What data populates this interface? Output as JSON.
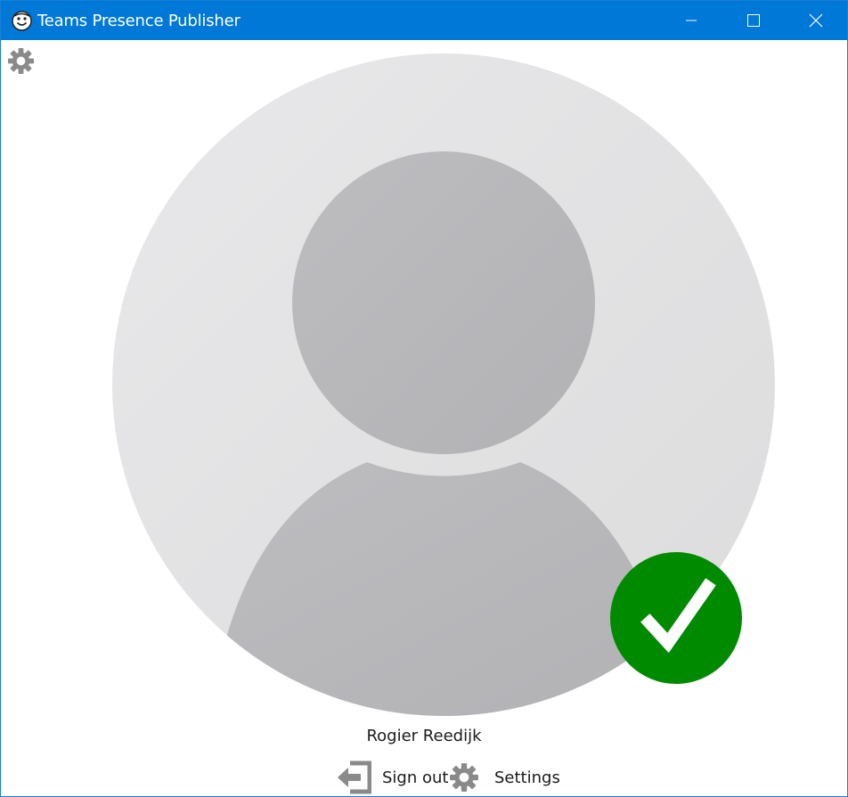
{
  "window": {
    "title": "Teams Presence Publisher",
    "icons": {
      "app": "smiley-face-icon",
      "minimize": "minimize-icon",
      "maximize": "maximize-icon",
      "close": "close-icon"
    }
  },
  "toolbar": {
    "gear_icon": "gear-icon"
  },
  "profile": {
    "avatar_icon": "default-person-avatar-icon",
    "status": "available",
    "status_color": "#008a00",
    "status_icon": "checkmark-icon",
    "user_name": "Rogier Reedijk"
  },
  "actions": {
    "sign_out_label": "Sign out",
    "sign_out_icon": "sign-out-arrow-icon",
    "settings_label": "Settings",
    "settings_icon": "gear-icon"
  },
  "colors": {
    "titlebar": "#0078d7",
    "avatar_bg": "#e6e6e8",
    "avatar_figure": "#b8b8bb"
  }
}
